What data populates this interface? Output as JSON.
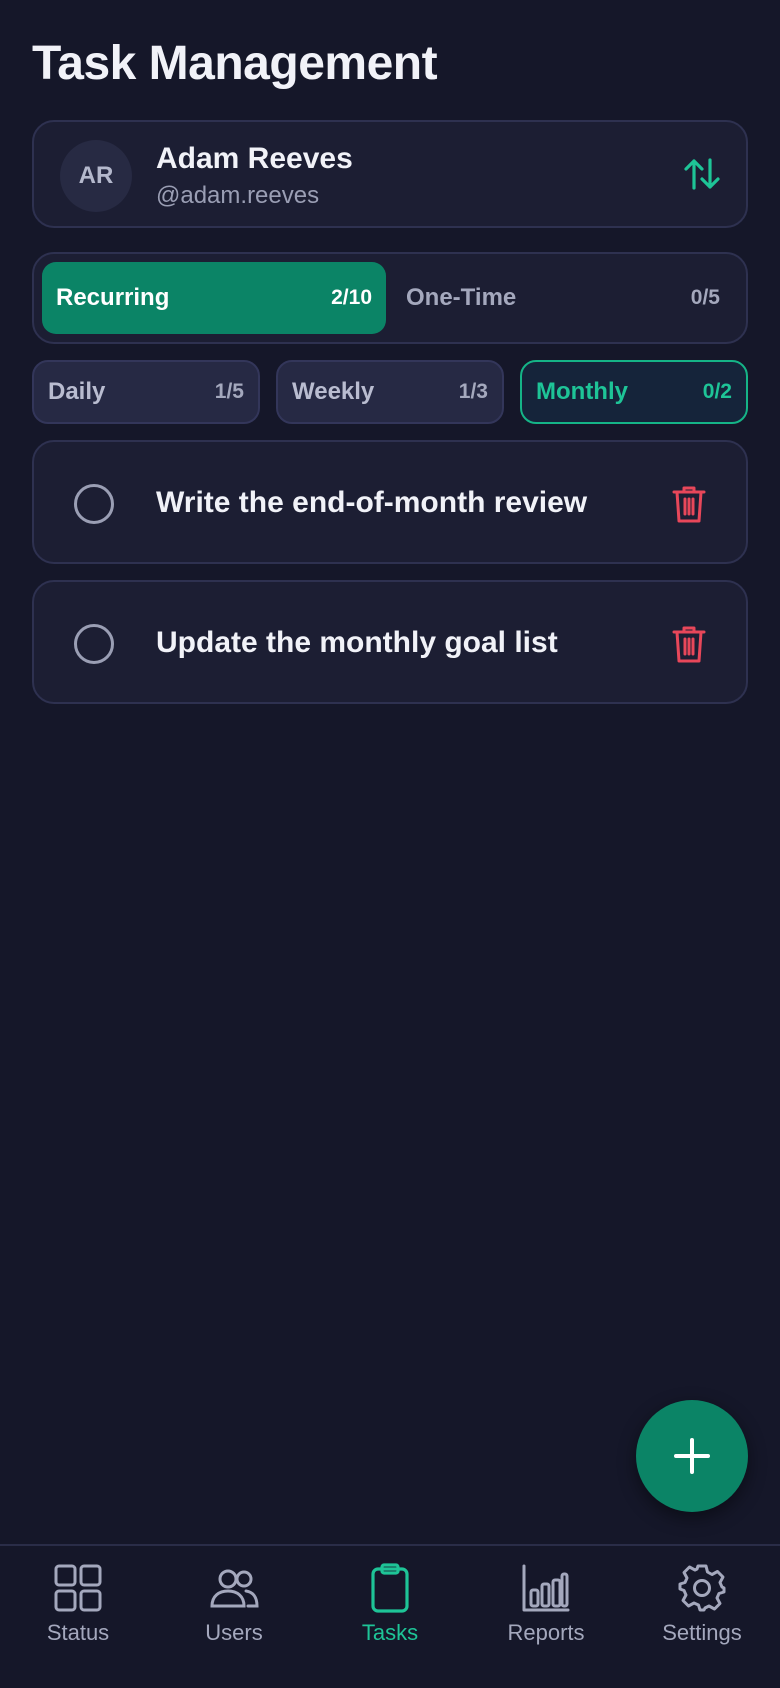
{
  "page": {
    "title": "Task Management"
  },
  "user": {
    "initials": "AR",
    "name": "Adam Reeves",
    "handle": "@adam.reeves"
  },
  "icons": {
    "swap": "swap-vertical-icon",
    "delete": "trash-icon",
    "add": "plus-icon"
  },
  "task_type_tabs": [
    {
      "label": "Recurring",
      "count": "2/10",
      "active": true
    },
    {
      "label": "One-Time",
      "count": "0/5",
      "active": false
    }
  ],
  "frequency_tabs": [
    {
      "label": "Daily",
      "count": "1/5",
      "active": false
    },
    {
      "label": "Weekly",
      "count": "1/3",
      "active": false
    },
    {
      "label": "Monthly",
      "count": "0/2",
      "active": true
    }
  ],
  "tasks": [
    {
      "text": "Write the end-of-month review",
      "completed": false
    },
    {
      "text": "Update the monthly goal list",
      "completed": false
    }
  ],
  "bottom_nav": [
    {
      "label": "Status",
      "icon": "grid-icon",
      "active": false
    },
    {
      "label": "Users",
      "icon": "users-icon",
      "active": false
    },
    {
      "label": "Tasks",
      "icon": "clipboard-icon",
      "active": true
    },
    {
      "label": "Reports",
      "icon": "bar-chart-icon",
      "active": false
    },
    {
      "label": "Settings",
      "icon": "gear-icon",
      "active": false
    }
  ],
  "colors": {
    "background": "#151729",
    "card": "#1c1e33",
    "accent": "#0b8466",
    "accent_text": "#1ec497",
    "danger": "#e8475a",
    "muted": "#a4a8bd"
  }
}
